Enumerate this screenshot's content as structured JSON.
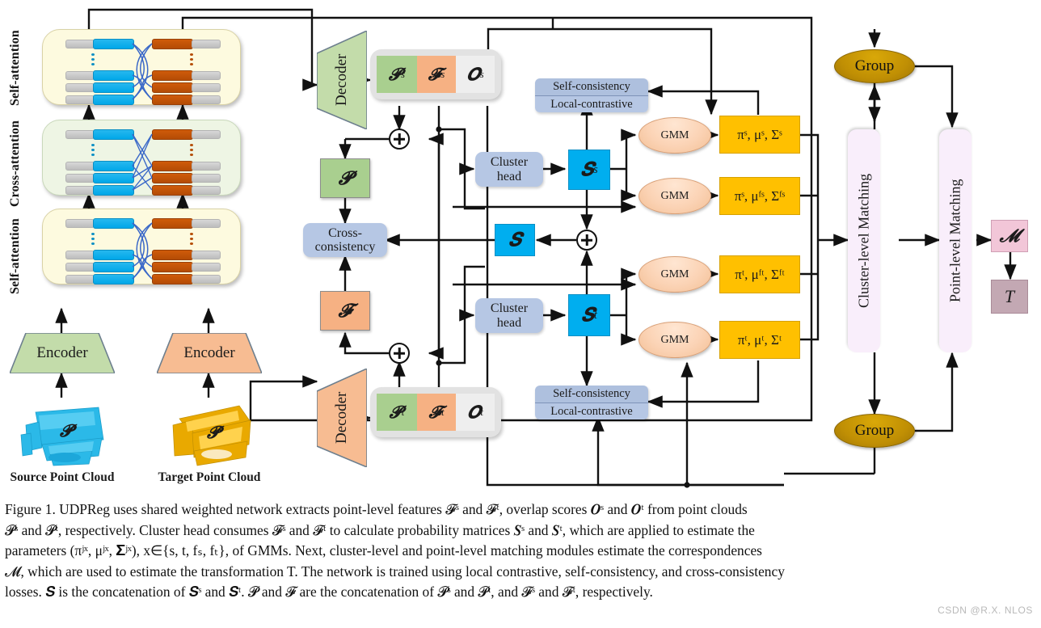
{
  "figure": {
    "label": "Figure 1.",
    "caption_lines": [
      "Figure 1. UDPReg uses shared weighted network extracts point-level features 𝓕ˢ and 𝓕ᵗ, overlap scores 𝑶ˢ and 𝑶ᵗ from point clouds",
      "𝓟ˢ and 𝓟ᵗ, respectively. Cluster head consumes 𝓕ˢ and 𝓕ᵗ to calculate probability matrices 𝑺ˢ and 𝑺ᵗ, which are applied to estimate the",
      "parameters (πʲˣ, μʲˣ, 𝚺ʲˣ), x∈{s, t, fₛ, fₜ}, of GMMs. Next, cluster-level and point-level matching modules estimate the correspondences",
      "𝓜, which are used to estimate the transformation T. The network is trained using local contrastive, self-consistency, and cross-consistency",
      "losses. 𝑺 is the concatenation of 𝑺ˢ and 𝑺ᵗ. 𝓟 and 𝓕 are the concatenation of 𝓟ˢ and 𝓟ᵗ, and 𝓕ˢ and 𝓕ᵗ, respectively."
    ],
    "watermark": "CSDN @R.X. NLOS"
  },
  "side_labels": {
    "top_self_attention": "Self-attention",
    "cross_attention": "Cross-attention",
    "bottom_self_attention": "Self-attention"
  },
  "inputs": {
    "source": {
      "encoder_label": "Encoder",
      "cloud_symbol": "𝓟",
      "cloud_sup": "s",
      "caption": "Source Point Cloud"
    },
    "target": {
      "encoder_label": "Encoder",
      "cloud_symbol": "𝓟",
      "cloud_sup": "t",
      "caption": "Target Point Cloud"
    }
  },
  "decoders": {
    "source": "Decoder",
    "target": "Decoder"
  },
  "feature_groups": {
    "source": {
      "p": "𝓟",
      "p_sup": "s",
      "f": "𝓕",
      "f_sup": "s",
      "o": "𝑶",
      "o_sup": "s"
    },
    "target": {
      "p": "𝓟",
      "p_sup": "t",
      "f": "𝓕",
      "f_sup": "t",
      "o": "𝑶",
      "o_sup": "t"
    }
  },
  "concat": {
    "p": "𝓟",
    "f": "𝓕",
    "s": "𝑺"
  },
  "losses": {
    "cross_consistency_line1": "Cross-",
    "cross_consistency_line2": "consistency",
    "self_consistency": "Self-consistency",
    "local_contrastive": "Local-contrastive"
  },
  "cluster_heads": {
    "line1": "Cluster",
    "line2": "head"
  },
  "prob_matrices": {
    "source": "𝑺",
    "source_sup": "s",
    "target": "𝑺",
    "target_sup": "t"
  },
  "gmm_label": "GMM",
  "gmm_params": {
    "source_point": "πˢ, μˢ, Σˢ",
    "source_feat": "πˢ, μᶠˢ, Σᶠˢ",
    "target_feat": "πᵗ, μᶠᵗ, Σᶠᵗ",
    "target_point": "πᵗ, μᵗ, Σᵗ"
  },
  "group_label": "Group",
  "matching": {
    "cluster_level": "Cluster-level Matching",
    "point_level": "Point-level Matching"
  },
  "outputs": {
    "correspondences": "𝓜",
    "transformation": "T"
  },
  "colors": {
    "source_green": "#a9cf8f",
    "target_orange": "#f6b183",
    "cyan": "#00aeef",
    "yellow": "#ffc000",
    "blue_box": "#b6c7e4",
    "group_gold": "#c08f04",
    "pink": "#f2c6d8",
    "mauve": "#c3a8b3",
    "self_attn_bg": "#fdfadf",
    "cross_attn_bg": "#eef5e4"
  },
  "chart_data": {
    "type": "diagram",
    "title": "UDPReg architecture block diagram",
    "nodes": [
      "Source Point Cloud",
      "Target Point Cloud",
      "Encoder (source)",
      "Encoder (target)",
      "Self-attention (lower)",
      "Cross-attention",
      "Self-attention (upper)",
      "Decoder (source)",
      "Decoder (target)",
      "P^s F^s O^s",
      "P^t F^t O^t",
      "P",
      "F",
      "Cross-consistency",
      "Cluster head (source)",
      "Cluster head (target)",
      "S^s",
      "S^t",
      "S",
      "GMM x4",
      "pi^s mu^s Sigma^s",
      "pi^s mu^fs Sigma^fs",
      "pi^t mu^ft Sigma^ft",
      "pi^t mu^t Sigma^t",
      "Self-consistency / Local-contrastive (source)",
      "Self-consistency / Local-contrastive (target)",
      "Group (top)",
      "Group (bottom)",
      "Cluster-level Matching",
      "Point-level Matching",
      "M",
      "T"
    ]
  }
}
